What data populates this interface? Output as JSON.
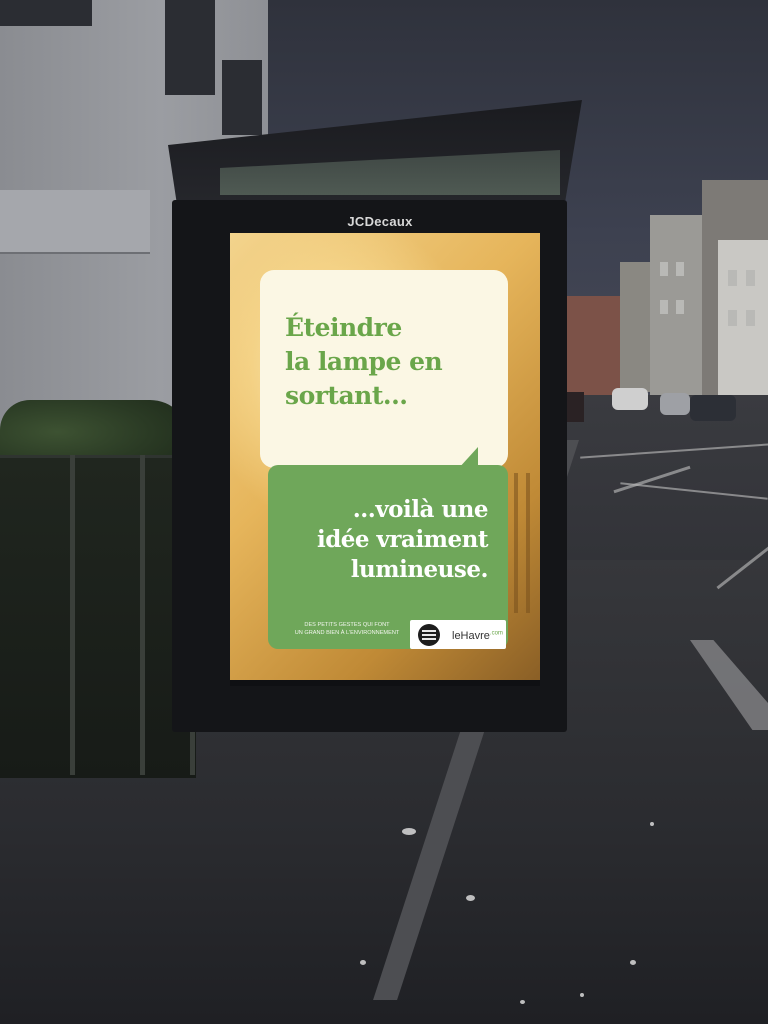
{
  "shelter": {
    "brand": "JCDecaux"
  },
  "poster": {
    "headline": [
      "Éteindre",
      "la lampe en",
      "sortant..."
    ],
    "answer": [
      "...voilà une",
      "idée vraiment",
      "lumineuse."
    ],
    "tagline": [
      "DES PETITS GESTES QUI FONT",
      "UN GRAND BIEN À L'ENVIRONNEMENT"
    ],
    "logo": {
      "name": "leHavre",
      "suffix": ".com"
    },
    "colors": {
      "green": "#6fa75a",
      "cream": "#fbf7e4",
      "warm_light": "#e6b55b"
    }
  },
  "scene": {
    "colors": {
      "sky": "#3d4150",
      "pavement": "#2a2b2f"
    }
  }
}
